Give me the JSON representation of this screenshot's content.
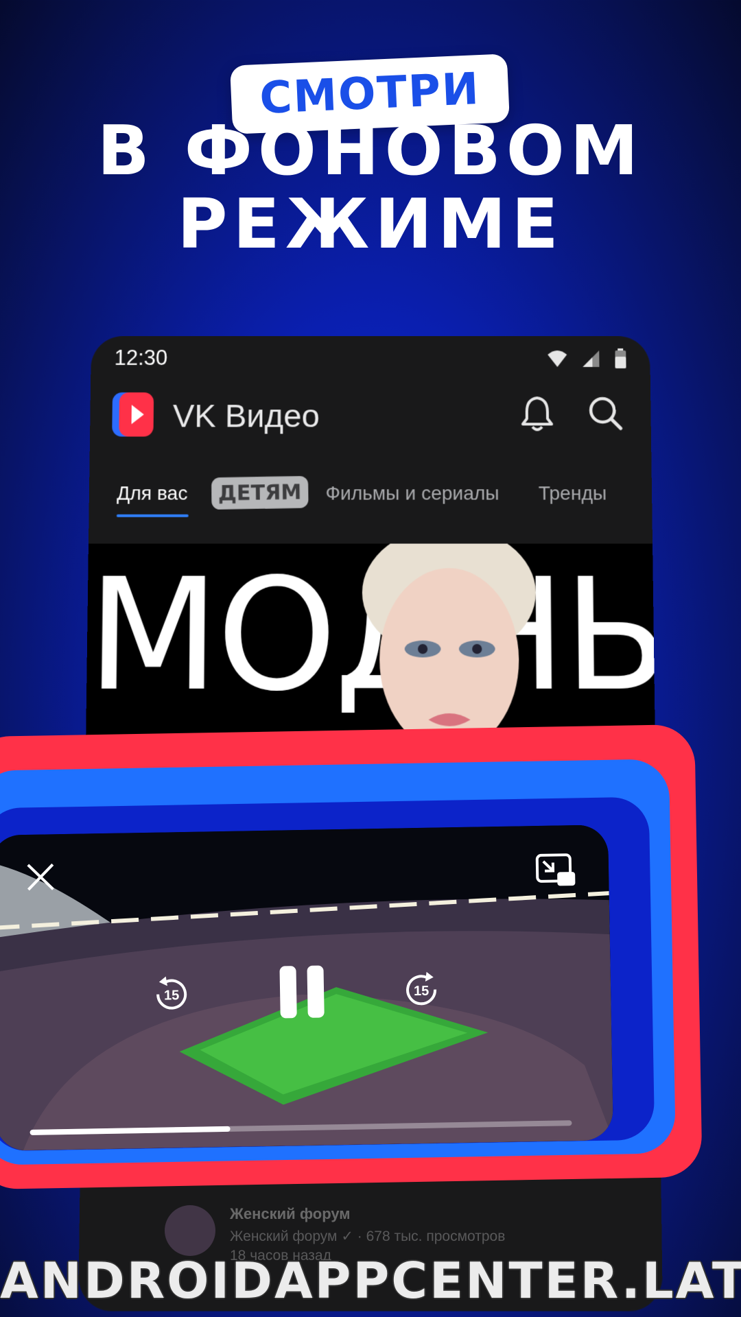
{
  "headline": {
    "pill_text": "СМОТРИ",
    "line1": "В ФОНОВОМ",
    "line2": "РЕЖИМЕ"
  },
  "phone": {
    "status_time": "12:30",
    "app_title": "VK Видео",
    "tabs": [
      {
        "label": "Для вас",
        "active": true
      },
      {
        "label": "ДЕТЯМ",
        "active": false
      },
      {
        "label": "Фильмы и сериалы",
        "active": false
      },
      {
        "label": "Тренды",
        "active": false
      }
    ],
    "banner_text": "МОДНЫЙ"
  },
  "card": {
    "title": "Женский форум",
    "meta": "Женский форум ✓ · 678 тыс. просмотров",
    "time": "18 часов назад"
  },
  "player": {
    "rewind_label": "15",
    "forward_label": "15",
    "progress": 0.37
  },
  "colors": {
    "accent_blue": "#1f71ff",
    "accent_red": "#ff3148",
    "tab_underline": "#2f7df5"
  },
  "icons": [
    "wifi-icon",
    "signal-icon",
    "battery-icon",
    "vk-video-logo",
    "bell-icon",
    "search-icon",
    "close-icon",
    "exit-pip-icon",
    "rewind-15-icon",
    "pause-icon",
    "forward-15-icon"
  ],
  "watermark": "ANDROIDAPPCENTER.LAT"
}
